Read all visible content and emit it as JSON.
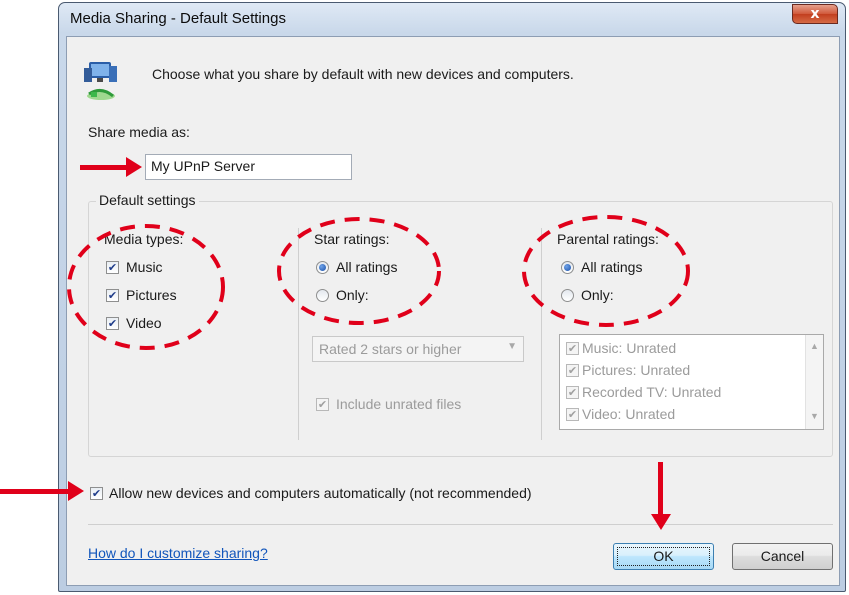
{
  "window": {
    "title": "Media Sharing - Default Settings",
    "close_glyph": "x"
  },
  "header": {
    "icon": "media-sharing-icon",
    "description": "Choose what you share by default with new devices and computers."
  },
  "share_media": {
    "label": "Share media as:",
    "value": "My UPnP Server"
  },
  "default_settings": {
    "legend": "Default settings",
    "media_types": {
      "label": "Media types:",
      "items": [
        {
          "label": "Music",
          "checked": true
        },
        {
          "label": "Pictures",
          "checked": true
        },
        {
          "label": "Video",
          "checked": true
        }
      ]
    },
    "star_ratings": {
      "label": "Star ratings:",
      "all_label": "All ratings",
      "only_label": "Only:",
      "selected": "All ratings",
      "dropdown_value": "Rated 2 stars or higher",
      "include_unrated_label": "Include unrated files"
    },
    "parental_ratings": {
      "label": "Parental ratings:",
      "all_label": "All ratings",
      "only_label": "Only:",
      "selected": "All ratings",
      "list": [
        "Music: Unrated",
        "Pictures: Unrated",
        "Recorded TV: Unrated",
        "Video: Unrated"
      ]
    }
  },
  "allow_new": {
    "label": "Allow new devices and computers automatically (not recommended)",
    "checked": true
  },
  "footer": {
    "help_link": "How do I customize sharing?",
    "ok_label": "OK",
    "cancel_label": "Cancel"
  },
  "annotations": {
    "color": "#e0001a"
  }
}
